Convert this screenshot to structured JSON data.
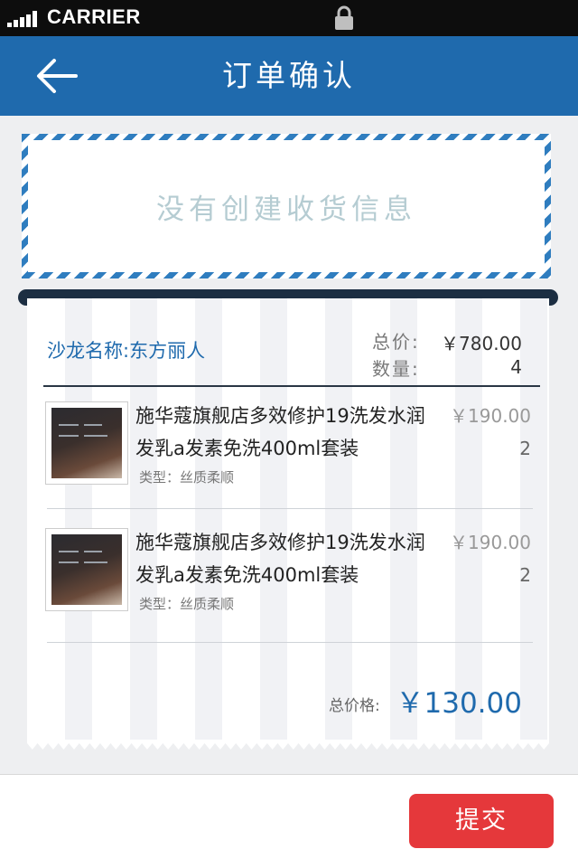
{
  "status_bar": {
    "carrier": "CARRIER"
  },
  "nav": {
    "title": "订单确认"
  },
  "address": {
    "empty_text": "没有创建收货信息"
  },
  "order": {
    "salon": "沙龙名称:东方丽人",
    "total_price_label": "总价:",
    "total_price": "￥780.00",
    "quantity_label": "数量:",
    "quantity": "4",
    "items": [
      {
        "name": "施华蔻旗舰店多效修护19洗发水润发乳a发素免洗400ml套装",
        "type": "类型：丝质柔顺",
        "price": "￥190.00",
        "qty": "2"
      },
      {
        "name": "施华蔻旗舰店多效修护19洗发水润发乳a发素免洗400ml套装",
        "type": "类型：丝质柔顺",
        "price": "￥190.00",
        "qty": "2"
      }
    ],
    "grand_total_label": "总价格:",
    "grand_total": "￥130.00"
  },
  "footer": {
    "submit_label": "提交"
  },
  "colors": {
    "nav_bg": "#1f6aad",
    "accent": "#1f6aad",
    "submit_bg": "#e5383b",
    "address_border": "#2f7dbf"
  },
  "icons": {
    "back": "arrow-left-icon",
    "lock": "lock-icon",
    "signal": "signal-icon"
  }
}
